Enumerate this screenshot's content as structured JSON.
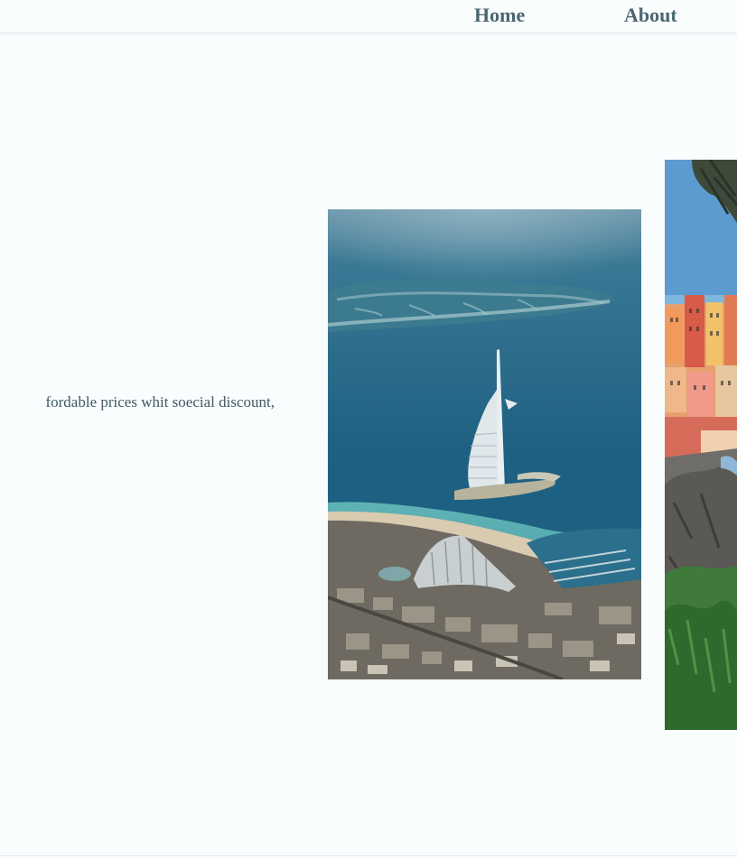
{
  "nav": {
    "home_label": "Home",
    "about_label": "About"
  },
  "hero": {
    "text": "fordable prices whit soecial discount,"
  },
  "gallery": {
    "photos": [
      {
        "subject": "aerial-view-dubai-coast-image"
      },
      {
        "subject": "colorful-cliffside-village-image"
      }
    ]
  },
  "colors": {
    "background": "#fafdfe",
    "nav_text": "#4a6670",
    "body_text": "#3f5a63",
    "sea": "#2a6f8c"
  }
}
